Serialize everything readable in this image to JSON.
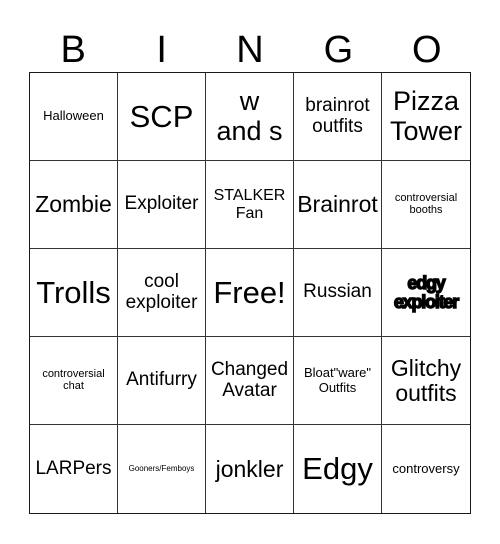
{
  "header": {
    "letters": [
      "B",
      "I",
      "N",
      "G",
      "O"
    ]
  },
  "cells": [
    {
      "text": "Halloween",
      "size": "s-s"
    },
    {
      "text": "SCP",
      "size": "s-xxxl"
    },
    {
      "text": "w and s",
      "size": "s-xxl"
    },
    {
      "text": "brainrot outfits",
      "size": "s-l"
    },
    {
      "text": "Pizza Tower",
      "size": "s-xxl"
    },
    {
      "text": "Zombie",
      "size": "s-xl"
    },
    {
      "text": "Exploiter",
      "size": "s-l"
    },
    {
      "text": "STALKER Fan",
      "size": "s-m"
    },
    {
      "text": "Brainrot",
      "size": "s-xl"
    },
    {
      "text": "controversial booths",
      "size": "s-xs",
      "extra": "cs"
    },
    {
      "text": "Trolls",
      "size": "s-xxxl"
    },
    {
      "text": "cool exploiter",
      "size": "s-l"
    },
    {
      "text": "Free!",
      "size": "s-xxxl",
      "free": true
    },
    {
      "text": "Russian",
      "size": "s-l"
    },
    {
      "text": "edgy exploiter",
      "size": "heavy"
    },
    {
      "text": "controversial chat",
      "size": "s-xs",
      "extra": "cs"
    },
    {
      "text": "Antifurry",
      "size": "s-l"
    },
    {
      "text": "Changed Avatar",
      "size": "s-l"
    },
    {
      "text": "Bloat\"ware\" Outfits",
      "size": "s-s"
    },
    {
      "text": "Glitchy outfits",
      "size": "s-xl"
    },
    {
      "text": "LARPers",
      "size": "s-l"
    },
    {
      "text": "Gooners/Femboys",
      "size": "s-xs",
      "extra": "tiny"
    },
    {
      "text": "jonkler",
      "size": "s-xl"
    },
    {
      "text": "Edgy",
      "size": "s-xxxl"
    },
    {
      "text": "controversy",
      "size": "s-s"
    }
  ]
}
